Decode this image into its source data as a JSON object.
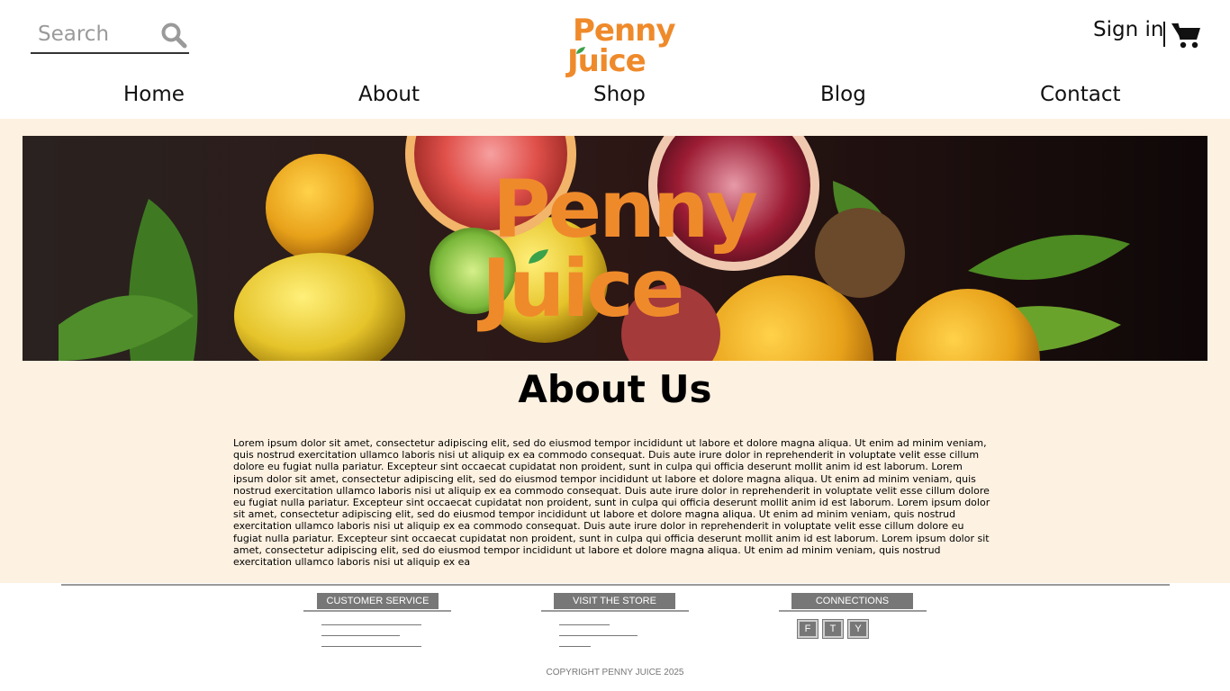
{
  "header": {
    "search_placeholder": "Search",
    "logo_line1": "Penny",
    "logo_line2": "Juice",
    "signin_label": "Sign in",
    "cart_icon": "shopping-cart-icon",
    "search_icon": "search-icon"
  },
  "nav": {
    "items": [
      {
        "label": "Home"
      },
      {
        "label": "About"
      },
      {
        "label": "Shop"
      },
      {
        "label": "Blog"
      },
      {
        "label": "Contact"
      }
    ]
  },
  "hero": {
    "logo_line1": "Penny",
    "logo_line2": "Juice"
  },
  "main": {
    "title": "About Us",
    "body": "Lorem ipsum dolor sit amet, consectetur adipiscing elit, sed do eiusmod tempor incididunt ut labore et dolore magna aliqua. Ut enim ad minim veniam, quis nostrud exercitation ullamco laboris nisi ut aliquip ex ea commodo consequat. Duis aute irure dolor in reprehenderit in voluptate velit esse cillum dolore eu fugiat nulla pariatur. Excepteur sint occaecat cupidatat non proident, sunt in culpa qui officia deserunt mollit anim id est laborum. Lorem ipsum dolor sit amet, consectetur adipiscing elit, sed do eiusmod tempor incididunt ut labore et dolore magna aliqua. Ut enim ad minim veniam, quis nostrud exercitation ullamco laboris nisi ut aliquip ex ea commodo consequat. Duis aute irure dolor in reprehenderit in voluptate velit esse cillum dolore eu fugiat nulla pariatur. Excepteur sint occaecat cupidatat non proident, sunt in culpa qui officia deserunt mollit anim id est laborum. Lorem ipsum dolor sit amet, consectetur adipiscing elit, sed do eiusmod tempor incididunt ut labore et dolore magna aliqua. Ut enim ad minim veniam, quis nostrud exercitation ullamco laboris nisi ut aliquip ex ea commodo consequat. Duis aute irure dolor in reprehenderit in voluptate velit esse cillum dolore eu fugiat nulla pariatur. Excepteur sint occaecat cupidatat non proident, sunt in culpa qui officia deserunt mollit anim id est laborum. Lorem ipsum dolor sit amet, consectetur adipiscing elit, sed do eiusmod tempor incididunt ut labore et dolore magna aliqua. Ut enim ad minim veniam, quis nostrud exercitation ullamco laboris nisi ut aliquip ex ea"
  },
  "footer": {
    "customer_service": "CUSTOMER SERVICE",
    "visit_store": "VISIT THE STORE",
    "connections": "CONNECTIONS",
    "social": [
      "F",
      "T",
      "Y"
    ],
    "copyright": "COPYRIGHT PENNY JUICE 2025"
  },
  "colors": {
    "brand_orange": "#ef8a2b",
    "leaf_green": "#3aa24a",
    "content_background": "#fdf1e1",
    "footer_gray": "#777777"
  }
}
